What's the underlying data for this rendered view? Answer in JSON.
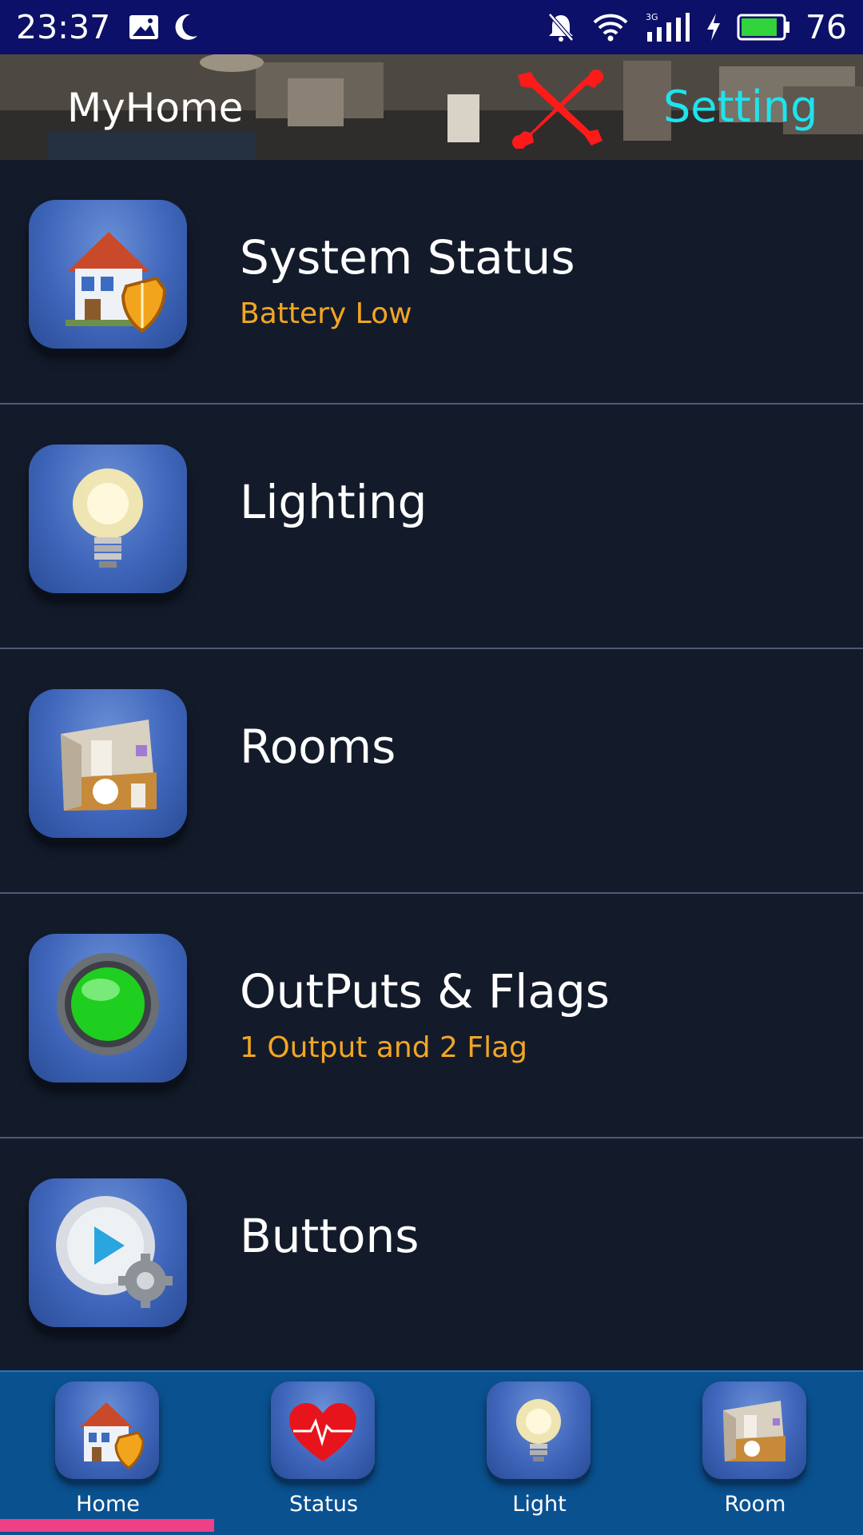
{
  "status_bar": {
    "time": "23:37",
    "battery_level": "76",
    "icons": [
      "image-icon",
      "moon-icon",
      "bell-muted-icon",
      "wifi-icon",
      "signal-3g-icon",
      "charging-icon",
      "battery-icon"
    ]
  },
  "header": {
    "title": "MyHome",
    "setting_label": "Setting",
    "tools_icon": "tools-icon"
  },
  "menu": {
    "items": [
      {
        "title": "System Status",
        "subtitle": "Battery Low",
        "icon": "house-shield-icon"
      },
      {
        "title": "Lighting",
        "subtitle": "",
        "icon": "light-bulb-icon"
      },
      {
        "title": "Rooms",
        "subtitle": "",
        "icon": "room-icon"
      },
      {
        "title": "OutPuts & Flags",
        "subtitle": "1 Output and 2 Flag",
        "icon": "green-light-icon"
      },
      {
        "title": "Buttons",
        "subtitle": "",
        "icon": "play-gear-icon"
      }
    ]
  },
  "bottom_nav": {
    "items": [
      {
        "label": "Home",
        "icon": "house-shield-icon",
        "active": true
      },
      {
        "label": "Status",
        "icon": "heart-pulse-icon",
        "active": false
      },
      {
        "label": "Light",
        "icon": "light-bulb-icon",
        "active": false
      },
      {
        "label": "Room",
        "icon": "room-icon",
        "active": false
      }
    ]
  },
  "colors": {
    "status_bar": "#0c1068",
    "background": "#131b2b",
    "accent_setting": "#1fe3ee",
    "subtitle": "#f3a623",
    "nav_background": "#0a5190",
    "active_indicator": "#ef3f86"
  }
}
